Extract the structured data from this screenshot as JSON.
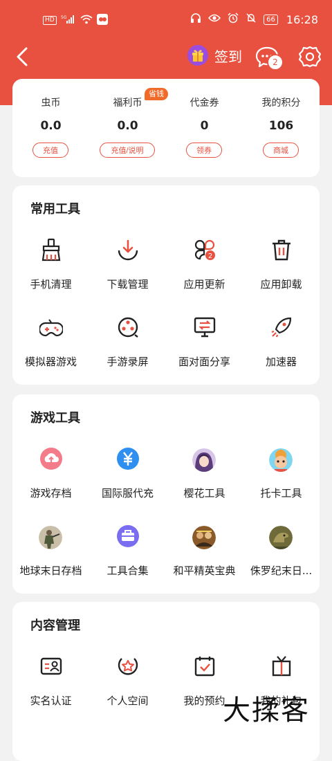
{
  "status_bar": {
    "left_items": [
      "HD",
      "5G",
      "signal",
      "wifi",
      "app-notif"
    ],
    "time": "16:28",
    "battery": "66"
  },
  "app_bar": {
    "signin_label": "签到",
    "message_badge": "2"
  },
  "wallet": [
    {
      "label": "虫币",
      "value": "0.0",
      "button": "充值"
    },
    {
      "label": "福利币",
      "value": "0.0",
      "button": "充值/说明",
      "badge": "省钱"
    },
    {
      "label": "代金券",
      "value": "0",
      "button": "领券"
    },
    {
      "label": "我的积分",
      "value": "106",
      "button": "商城"
    }
  ],
  "common_tools": {
    "title": "常用工具",
    "items": [
      {
        "label": "手机清理",
        "icon": "broom-icon"
      },
      {
        "label": "下载管理",
        "icon": "download-icon"
      },
      {
        "label": "应用更新",
        "icon": "app-update-icon",
        "badge": "2"
      },
      {
        "label": "应用卸载",
        "icon": "trash-icon"
      },
      {
        "label": "模拟器游戏",
        "icon": "gamepad-icon"
      },
      {
        "label": "手游录屏",
        "icon": "film-reel-icon"
      },
      {
        "label": "面对面分享",
        "icon": "share-screen-icon"
      },
      {
        "label": "加速器",
        "icon": "rocket-icon"
      }
    ]
  },
  "game_tools": {
    "title": "游戏工具",
    "items": [
      {
        "label": "游戏存档",
        "icon": "cloud-upload-icon"
      },
      {
        "label": "国际服代充",
        "icon": "yuan-coin-icon"
      },
      {
        "label": "樱花工具",
        "icon": "anime-girl-avatar"
      },
      {
        "label": "托卡工具",
        "icon": "toca-avatar"
      },
      {
        "label": "地球末日存档",
        "icon": "soldier-avatar"
      },
      {
        "label": "工具合集",
        "icon": "toolbox-icon"
      },
      {
        "label": "和平精英宝典",
        "icon": "pubg-avatar"
      },
      {
        "label": "侏罗纪末日...",
        "icon": "dino-avatar"
      }
    ]
  },
  "content_mgmt": {
    "title": "内容管理",
    "items": [
      {
        "label": "实名认证",
        "icon": "id-card-icon"
      },
      {
        "label": "个人空间",
        "icon": "star-badge-icon"
      },
      {
        "label": "我的预约",
        "icon": "calendar-check-icon"
      },
      {
        "label": "我的礼包",
        "icon": "gift-box-icon"
      }
    ]
  },
  "watermark": "大揉客",
  "colors": {
    "accent": "#e8513f",
    "badge": "#f26a2a",
    "background": "#f2f2f2"
  }
}
